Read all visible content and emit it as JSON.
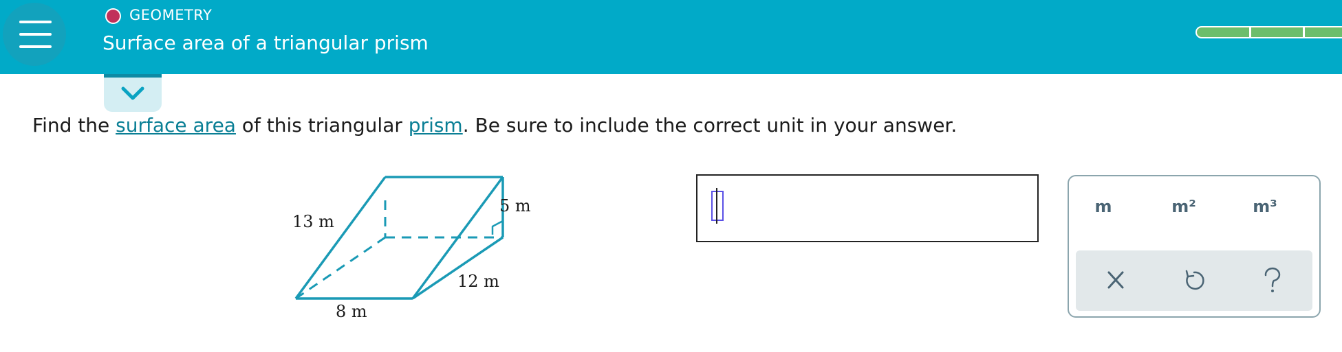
{
  "header": {
    "category": "GEOMETRY",
    "title": "Surface area of a triangular prism",
    "menu_icon": "hamburger-menu-icon",
    "category_dot_color": "#c1305a",
    "bar_color": "#01aac8"
  },
  "question": {
    "before": "Find the ",
    "link1": "surface area",
    "middle": " of this triangular ",
    "link2": "prism",
    "after": ". Be sure to include the correct unit in your answer."
  },
  "figure": {
    "labels": {
      "left_edge": "13 m",
      "height": "5 m",
      "length": "12 m",
      "base": "8 m"
    }
  },
  "answer": {
    "value": ""
  },
  "keypad": {
    "units": [
      "m",
      "m²",
      "m³"
    ],
    "actions": [
      "clear-icon",
      "undo-icon",
      "help-icon"
    ],
    "action_glyphs": {
      "clear": "×",
      "help": "?"
    }
  },
  "progress": {
    "completed_segments": 3,
    "color": "#6cbe6c"
  }
}
